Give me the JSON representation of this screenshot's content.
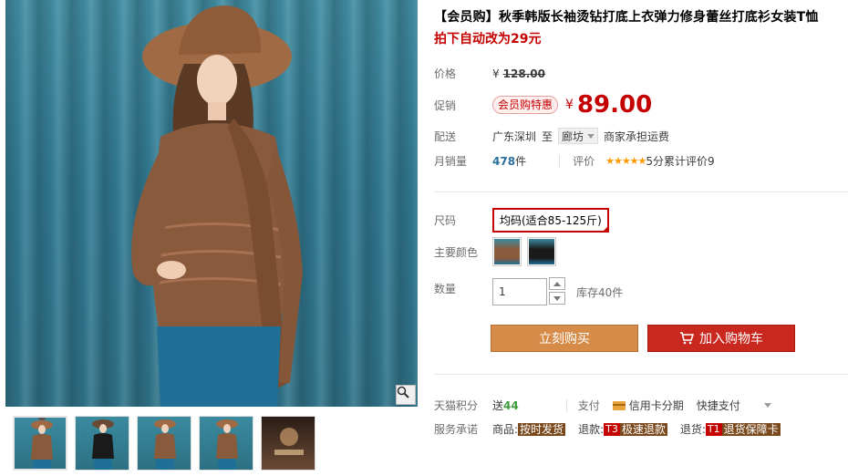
{
  "product": {
    "title": "【会员购】秋季韩版长袖烫钻打底上衣弹力修身蕾丝打底衫女装T恤",
    "subtitle": "拍下自动改为29元"
  },
  "price": {
    "label": "价格",
    "currency": "¥",
    "original": "128.00"
  },
  "promo": {
    "label": "促销",
    "badge": "会员购特惠",
    "currency": "¥",
    "price": "89.00"
  },
  "delivery": {
    "label": "配送",
    "from": "广东深圳",
    "to_word": "至",
    "destination": "廊坊",
    "note": "商家承担运费"
  },
  "sales": {
    "label": "月销量",
    "count": "478",
    "unit": "件",
    "review_label": "评价",
    "stars": "★★★★★",
    "rating_text": "5分累计评价9"
  },
  "size": {
    "label": "尺码",
    "selected": "均码(适合85-125斤)"
  },
  "color": {
    "label": "主要颜色",
    "options": [
      "coffee",
      "black"
    ]
  },
  "quantity": {
    "label": "数量",
    "value": "1",
    "stock": "库存40件"
  },
  "actions": {
    "buy_now": "立刻购买",
    "add_to_cart": "加入购物车"
  },
  "points": {
    "label": "天猫积分",
    "prefix": "送",
    "value": "44"
  },
  "payment": {
    "label": "支付",
    "credit": "信用卡分期",
    "quick": "快捷支付"
  },
  "service": {
    "label": "服务承诺",
    "goods_label": "商品:",
    "goods_tag": "按时发货",
    "refund_label": "退款:",
    "refund_badge": "T3",
    "refund_tag": "极速退款",
    "return_label": "退货:",
    "return_badge": "T1",
    "return_tag": "退货保障卡"
  },
  "colors": {
    "accent": "#c40000",
    "buy_button": "#d68c48",
    "cart_button": "#c8281e"
  }
}
